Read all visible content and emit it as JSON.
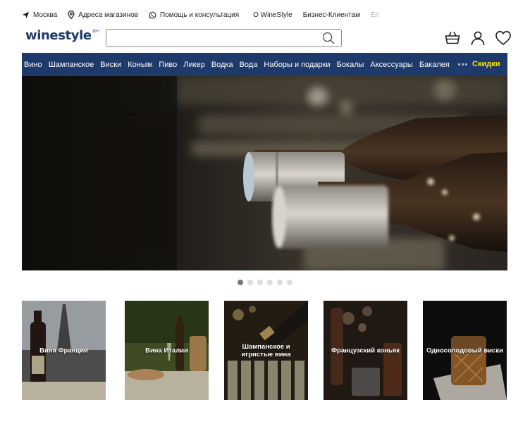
{
  "topbar": {
    "city": "Москва",
    "stores": "Адреса магазинов",
    "help": "Помощь и консультация",
    "about": "О WineStyle",
    "business": "Бизнес-Клиентам",
    "language": "En"
  },
  "header": {
    "logo_text": "winestyle",
    "logo_age": "18+",
    "search_value": "",
    "search_placeholder": "",
    "icons": [
      "basket-icon",
      "user-icon",
      "heart-icon"
    ]
  },
  "nav": {
    "items": [
      "Вино",
      "Шампанское",
      "Виски",
      "Коньяк",
      "Пиво",
      "Ликер",
      "Водка",
      "Вода",
      "Наборы и подарки",
      "Бокалы",
      "Аксессуары",
      "Бакалея"
    ],
    "more_icon": "more-dots-icon",
    "sale": "Скидки"
  },
  "carousel": {
    "slide_count": 6,
    "active_index": 0
  },
  "categories": [
    {
      "label": "Вина Франции"
    },
    {
      "label": "Вина Италии"
    },
    {
      "label": "Шампанское и игристые вина"
    },
    {
      "label": "Французский коньяк"
    },
    {
      "label": "Односолодовый виски"
    }
  ],
  "colors": {
    "brand": "#1d3a6b",
    "sale": "#ffe600"
  }
}
